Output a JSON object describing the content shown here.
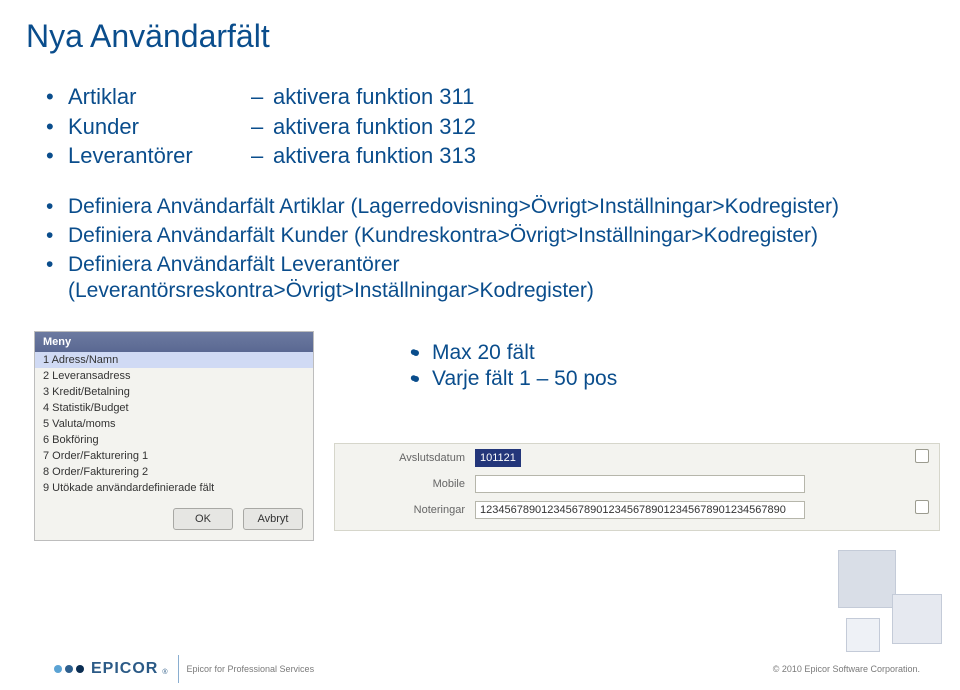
{
  "title": "Nya Användarfält",
  "top": {
    "left": [
      "Artiklar",
      "Kunder",
      "Leverantörer"
    ],
    "right": [
      "aktivera funktion 311",
      "aktivera funktion 312",
      "aktivera funktion 313"
    ]
  },
  "defs": [
    "Definiera Användarfält Artiklar (Lagerredovisning>Övrigt>Inställningar>Kodregister)",
    "Definiera Användarfält Kunder (Kundreskontra>Övrigt>Inställningar>Kodregister)",
    "Definiera Användarfält Leverantörer (Leverantörsreskontra>Övrigt>Inställningar>Kodregister)"
  ],
  "menu": {
    "header": "Meny",
    "items": [
      "1 Adress/Namn",
      "2 Leveransadress",
      "3 Kredit/Betalning",
      "4 Statistik/Budget",
      "5 Valuta/moms",
      "6 Bokföring",
      "7 Order/Fakturering 1",
      "8 Order/Fakturering 2",
      "9 Utökade användardefinierade fält"
    ],
    "ok": "OK",
    "cancel": "Avbryt"
  },
  "side": [
    "Max 20 fält",
    "Varje fält 1 – 50 pos"
  ],
  "form": {
    "labels": {
      "end": "Avslutsdatum",
      "mobile": "Mobile",
      "notes": "Noteringar"
    },
    "values": {
      "end": "101121",
      "mobile": "",
      "notes": "12345678901234567890123456789012345678901234567890"
    }
  },
  "footer": {
    "brand": "EPICOR",
    "service": "Epicor for Professional Services",
    "copyright": "© 2010 Epicor Software Corporation."
  }
}
